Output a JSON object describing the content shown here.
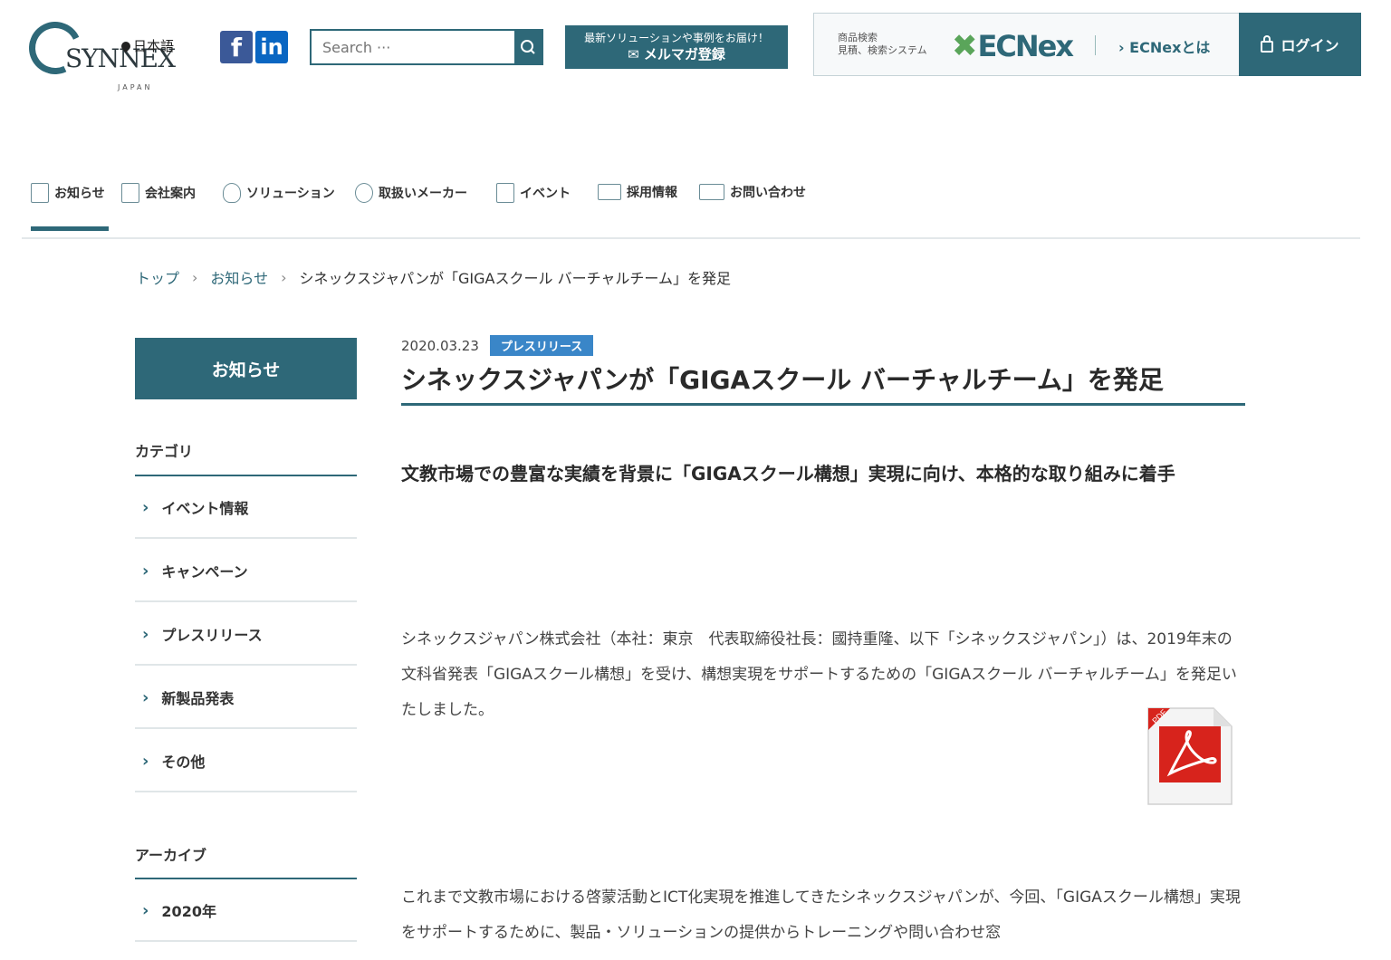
{
  "header": {
    "logo_text": "SYNNEX",
    "logo_sub": "JAPAN",
    "language": "日本語",
    "search_placeholder": "Search ···",
    "mail_line1": "最新ソリューションや事例をお届け！",
    "mail_line2": "メルマガ登録",
    "ec_small1": "商品検索",
    "ec_small2": "見積、検索システム",
    "ec_brand": "ECNex",
    "ec_about": "ECNexとは",
    "login": "ログイン"
  },
  "nav": [
    {
      "label": "お知らせ"
    },
    {
      "label": "会社案内"
    },
    {
      "label": "ソリューション"
    },
    {
      "label": "取扱いメーカー"
    },
    {
      "label": "イベント"
    },
    {
      "label": "採用情報"
    },
    {
      "label": "お問い合わせ"
    }
  ],
  "breadcrumb": [
    "トップ",
    "お知らせ",
    "シネックスジャパンが「GIGAスクール バーチャルチーム」を発足"
  ],
  "sidebar": {
    "heading": "お知らせ",
    "category_label": "カテゴリ",
    "categories": [
      "イベント情報",
      "キャンペーン",
      "プレスリリース",
      "新製品発表",
      "その他"
    ],
    "archive_label": "アーカイブ",
    "archives": [
      "2020年"
    ]
  },
  "article": {
    "date": "2020.03.23",
    "badge": "プレスリリース",
    "title": "シネックスジャパンが「GIGAスクール バーチャルチーム」を発足",
    "lead": "文教市場での豊富な実績を背景に「GIGAスクール構想」実現に向け、本格的な取り組みに着手",
    "para1": "シネックスジャパン株式会社（本社：東京　代表取締役社長：國持重隆、以下「シネックスジャパン」）は、2019年末の文科省発表「GIGAスクール構想」を受け、構想実現をサポートするための「GIGAスクール バーチャルチーム」を発足いたしました。",
    "para2": "これまで文教市場における啓蒙活動とICT化実現を推進してきたシネックスジャパンが、今回、「GIGAスクール構想」実現をサポートするために、製品・ソリューションの提供からトレーニングや問い合わせ窓",
    "pdf_label": "PDF"
  }
}
